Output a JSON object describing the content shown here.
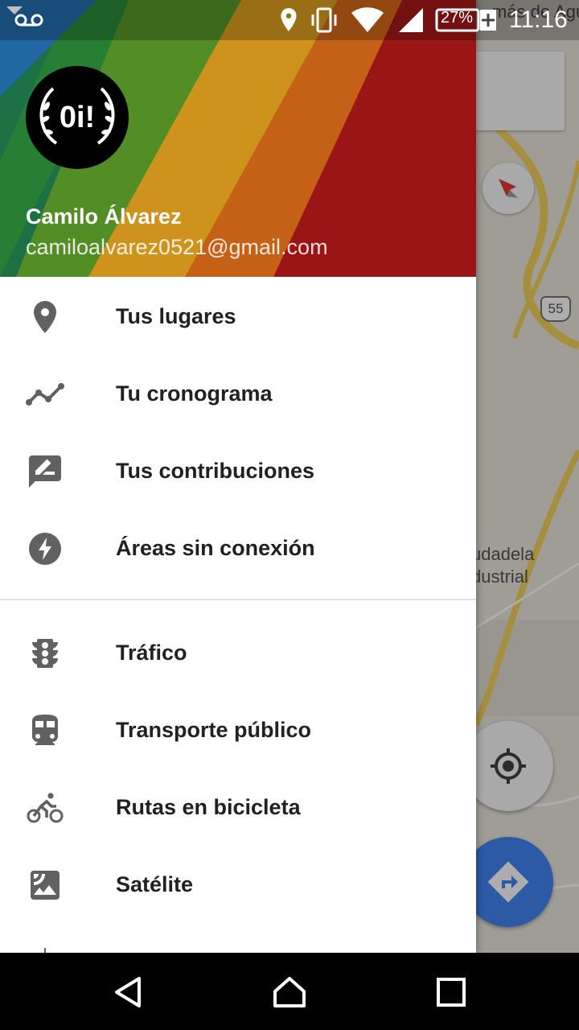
{
  "status_bar": {
    "time": "11:16",
    "battery_percent": "27%",
    "icons": [
      "voicemail-icon",
      "location-icon",
      "vibrate-icon",
      "wifi-icon",
      "signal-icon",
      "battery-charging-icon"
    ]
  },
  "map": {
    "labels": {
      "top_right": "más de Agu",
      "area_line1": "udadela",
      "area_line2": "dustrial"
    },
    "route_shield": "55",
    "accent_color": "#4285f4"
  },
  "drawer": {
    "account": {
      "name": "Camilo Álvarez",
      "email": "camiloalvarez0521@gmail.com",
      "avatar_text": "0i!"
    },
    "section1": [
      {
        "label": "Tus lugares",
        "icon": "place-pin-icon"
      },
      {
        "label": "Tu cronograma",
        "icon": "timeline-icon"
      },
      {
        "label": "Tus contribuciones",
        "icon": "rate-review-icon"
      },
      {
        "label": "Áreas sin conexión",
        "icon": "offline-bolt-icon"
      }
    ],
    "section2": [
      {
        "label": "Tráfico",
        "icon": "traffic-light-icon"
      },
      {
        "label": "Transporte público",
        "icon": "train-icon"
      },
      {
        "label": "Rutas en bicicleta",
        "icon": "bike-icon"
      },
      {
        "label": "Satélite",
        "icon": "satellite-image-icon"
      }
    ]
  },
  "nav_bar": {
    "buttons": [
      "back-icon",
      "home-icon",
      "recents-icon"
    ]
  }
}
